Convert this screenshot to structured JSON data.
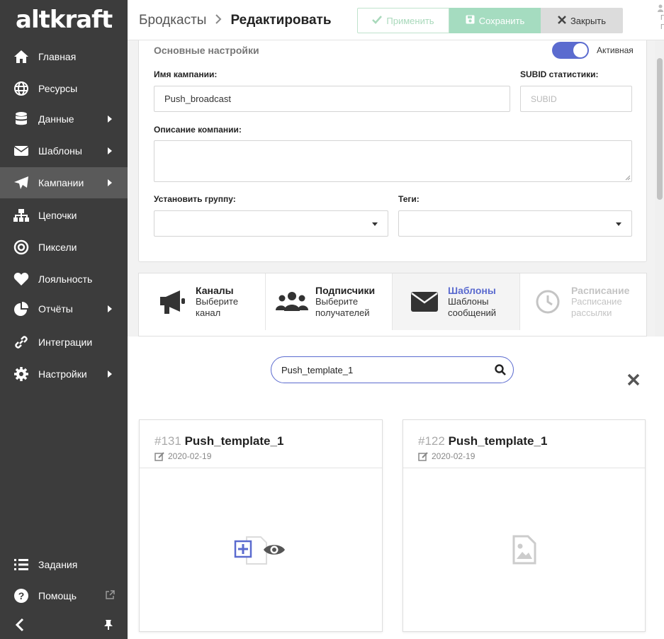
{
  "app": {
    "logo": "altkraft"
  },
  "sidebar": {
    "items": [
      {
        "label": "Главная"
      },
      {
        "label": "Ресурсы"
      },
      {
        "label": "Данные"
      },
      {
        "label": "Шаблоны"
      },
      {
        "label": "Кампании"
      },
      {
        "label": "Цепочки"
      },
      {
        "label": "Пиксели"
      },
      {
        "label": "Лояльность"
      },
      {
        "label": "Отчёты"
      },
      {
        "label": "Интеграции"
      },
      {
        "label": "Настройки"
      }
    ],
    "bottom": [
      {
        "label": "Задания"
      },
      {
        "label": "Помощь"
      }
    ]
  },
  "header": {
    "breadcrumb_root": "Бродкасты",
    "breadcrumb_current": "Редактировать",
    "apply_label": "Применить",
    "save_label": "Сохранить",
    "close_label": "Закрыть",
    "edge_text_1": "Г",
    "edge_text_2": "Г."
  },
  "settings": {
    "section_title": "Основные настройки",
    "active_label": "Активная",
    "active": true,
    "name_label": "Имя кампании:",
    "name_value": "Push_broadcast",
    "subid_label": "SUBID статистики:",
    "subid_placeholder": "SUBID",
    "desc_label": "Описание компании:",
    "group_label": "Установить группу:",
    "tags_label": "Теги:"
  },
  "steps": [
    {
      "title": "Каналы",
      "line1": "Выберите",
      "line2": "канал"
    },
    {
      "title": "Подписчики",
      "line1": "Выберите",
      "line2": "получателей"
    },
    {
      "title": "Шаблоны",
      "line1": "Шаблоны",
      "line2": "сообщений"
    },
    {
      "title": "Расписание",
      "line1": "Расписание",
      "line2": "рассылки"
    }
  ],
  "template_picker": {
    "search_value": "Push_template_1",
    "cards": [
      {
        "id": "#131",
        "name": "Push_template_1",
        "date": "2020-02-19"
      },
      {
        "id": "#122",
        "name": "Push_template_1",
        "date": "2020-02-19"
      }
    ]
  },
  "colors": {
    "accent": "#5b6bcf",
    "sidebar": "#3c3c3c",
    "success": "#a5dcc0"
  }
}
